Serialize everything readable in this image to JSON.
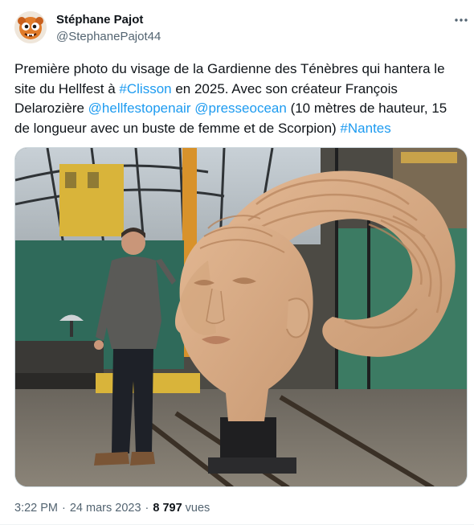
{
  "author": {
    "name": "Stéphane Pajot",
    "handle": "@StephanePajot44"
  },
  "tweet": {
    "part1": "Première photo du visage de la Gardienne des Ténèbres qui hantera le site du Hellfest à ",
    "hashtag_clisson": "#Clisson",
    "part2": " en 2025. Avec son créateur François Delarozière ",
    "mention_hellfest": "@hellfestopenair",
    "space": " ",
    "mention_presse": "@presseocean",
    "part3": " (10 mètres de hauteur, 15 de longueur avec un buste de femme et de Scorpion) ",
    "hashtag_nantes": "#Nantes"
  },
  "meta": {
    "time": "3:22 PM",
    "separator": "·",
    "date": "24 mars 2023",
    "views_count": "8 797",
    "views_label": "vues"
  },
  "icons": {
    "more": "more-dots-icon",
    "avatar": "avatar-illustration"
  },
  "colors": {
    "link": "#1d9bf0",
    "text": "#0f1419",
    "secondary": "#536471"
  }
}
